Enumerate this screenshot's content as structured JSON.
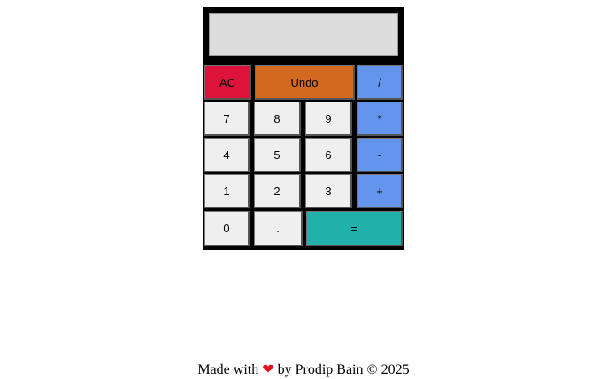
{
  "display": {
    "value": ""
  },
  "buttons": {
    "ac": "AC",
    "undo": "Undo",
    "divide": "/",
    "seven": "7",
    "eight": "8",
    "nine": "9",
    "multiply": "*",
    "four": "4",
    "five": "5",
    "six": "6",
    "minus": "-",
    "one": "1",
    "two": "2",
    "three": "3",
    "plus": "+",
    "zero": "0",
    "dot": ".",
    "equals": "="
  },
  "footer": {
    "prefix": "Made with",
    "heart": "❤",
    "suffix": "by Prodip Bain © 2025"
  },
  "colors": {
    "ac": "#dc143c",
    "undo": "#d2691e",
    "operator": "#6495ed",
    "equals": "#20b2aa",
    "digit": "#efefef",
    "display": "#dcdcdc",
    "frame": "#000000",
    "heart": "#e4101c"
  }
}
